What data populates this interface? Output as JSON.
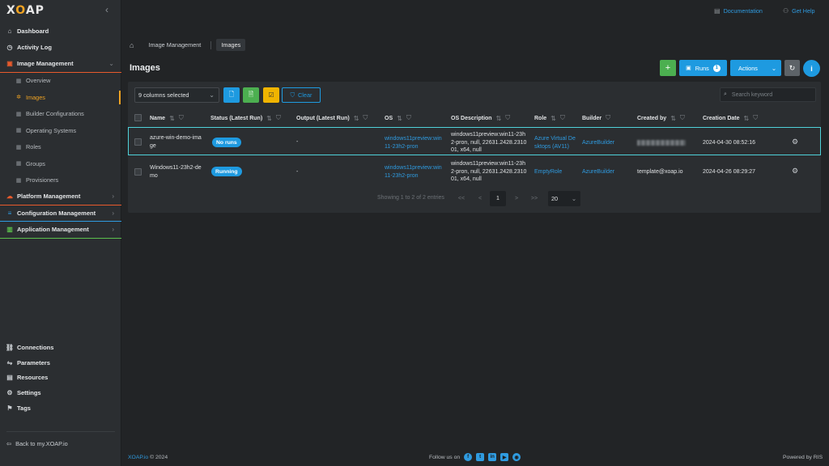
{
  "app": {
    "logo": "XOAP"
  },
  "sidebar": {
    "items": [
      {
        "label": "Dashboard",
        "icon": "dashboard-icon"
      },
      {
        "label": "Activity Log",
        "icon": "clock-icon"
      },
      {
        "label": "Image Management",
        "icon": "image-icon"
      },
      {
        "label": "Overview",
        "icon": "grid-icon"
      },
      {
        "label": "Images",
        "icon": "gear-icon"
      },
      {
        "label": "Builder Configurations",
        "icon": "grid-icon"
      },
      {
        "label": "Operating Systems",
        "icon": "grid-icon"
      },
      {
        "label": "Roles",
        "icon": "grid-icon"
      },
      {
        "label": "Groups",
        "icon": "grid-icon"
      },
      {
        "label": "Provisioners",
        "icon": "grid-icon"
      },
      {
        "label": "Platform Management",
        "icon": "cloud-icon"
      },
      {
        "label": "Configuration Management",
        "icon": "sliders-icon"
      },
      {
        "label": "Application Management",
        "icon": "chart-icon"
      }
    ],
    "bottom_items": [
      {
        "label": "Connections",
        "icon": "link-icon"
      },
      {
        "label": "Parameters",
        "icon": "parameters-icon"
      },
      {
        "label": "Resources",
        "icon": "resources-icon"
      },
      {
        "label": "Settings",
        "icon": "settings-icon"
      },
      {
        "label": "Tags",
        "icon": "tag-icon"
      }
    ],
    "back_link": "Back to my.XOAP.io"
  },
  "topbar": {
    "documentation": "Documentation",
    "get_help": "Get Help"
  },
  "breadcrumb": {
    "items": [
      "Image Management",
      "Images"
    ]
  },
  "page": {
    "title": "Images"
  },
  "toolbar": {
    "runs_label": "Runs",
    "runs_count": "1",
    "actions_label": "Actions",
    "columns_selected": "9 columns selected",
    "clear_label": "Clear",
    "search_placeholder": "Search keyword"
  },
  "table": {
    "headers": [
      "Name",
      "Status (Latest Run)",
      "Output (Latest Run)",
      "OS",
      "OS Description",
      "Role",
      "Builder",
      "Created by",
      "Creation Date"
    ],
    "rows": [
      {
        "name_1": "azure-win-demo-ima",
        "name_2": "ge",
        "status": "No runs",
        "output": "-",
        "os_1": "windows11preview:win",
        "os_2": "11-23h2-pron",
        "desc_1": "windows11preview:win11-23h",
        "desc_2": "2-pron, null, 22631.2428.2310",
        "desc_3": "01, x64, null",
        "role_1": "Azure Virtual De",
        "role_2": "sktops (AV11)",
        "builder": "AzureBuilder",
        "created_by": "",
        "date": "2024-04-30 08:52:16"
      },
      {
        "name_1": "Windows11-23h2-de",
        "name_2": "mo",
        "status": "Running",
        "output": "-",
        "os_1": "windows11preview:win",
        "os_2": "11-23h2-pron",
        "desc_1": "windows11preview:win11-23h",
        "desc_2": "2-pron, null, 22631.2428.2310",
        "desc_3": "01, x64, null",
        "role_1": "EmptyRole",
        "role_2": "",
        "builder": "AzureBuilder",
        "created_by": "template@xoap.io",
        "date": "2024-04-26 08:29:27"
      }
    ]
  },
  "pagination": {
    "summary": "Showing 1 to 2 of 2 entries",
    "first": "<<",
    "prev": "<",
    "page": "1",
    "next": ">",
    "last": ">>",
    "page_size": "20"
  },
  "footer": {
    "brand": "XOAP.io",
    "copyright": "© 2024",
    "follow": "Follow us on",
    "powered": "Powered by RIS"
  },
  "colors": {
    "accent": "#1e9ae0",
    "active": "#f0a323",
    "success": "#4caf50",
    "warning": "#f0b400"
  }
}
